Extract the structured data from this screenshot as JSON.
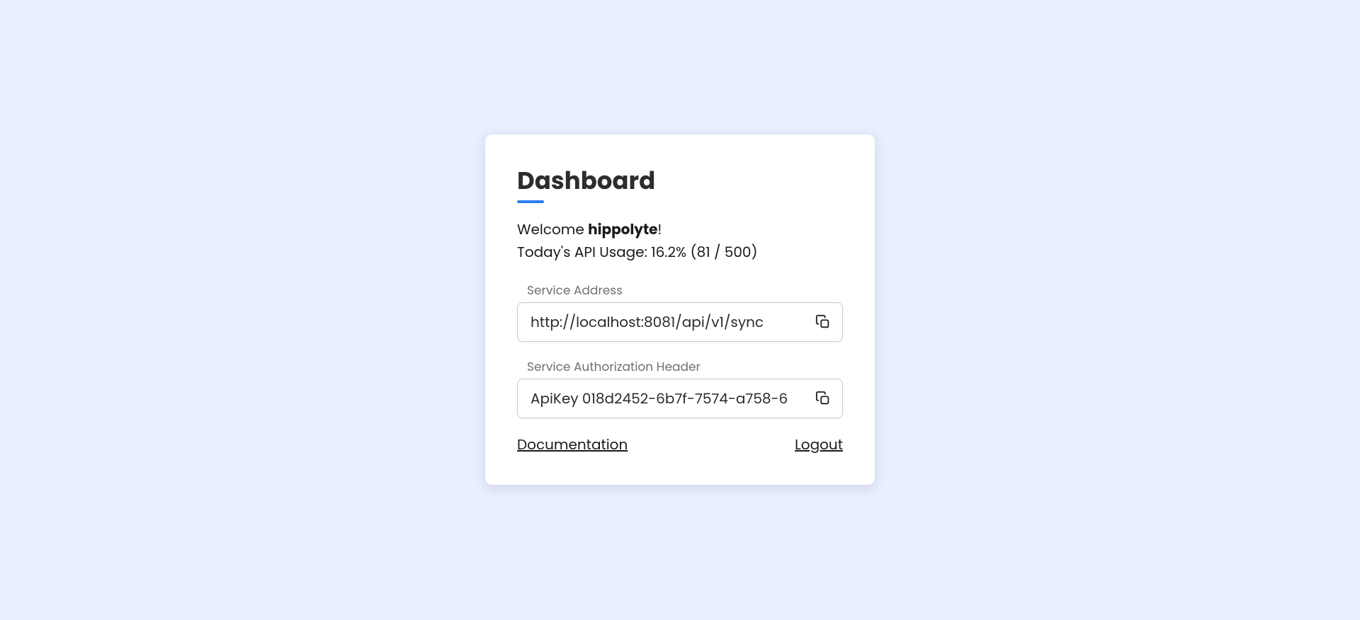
{
  "page_title": "Dashboard",
  "welcome": {
    "prefix": "Welcome ",
    "username": "hippolyte",
    "suffix": "!"
  },
  "usage": {
    "label_prefix": "Today's API Usage: ",
    "percent": "16.2%",
    "detail": " (81 / 500)"
  },
  "fields": {
    "service_address": {
      "label": "Service Address",
      "value": "http://localhost:8081/api/v1/sync"
    },
    "auth_header": {
      "label": "Service Authorization Header",
      "value": "ApiKey 018d2452-6b7f-7574-a758-6"
    }
  },
  "links": {
    "documentation": "Documentation",
    "logout": "Logout"
  }
}
